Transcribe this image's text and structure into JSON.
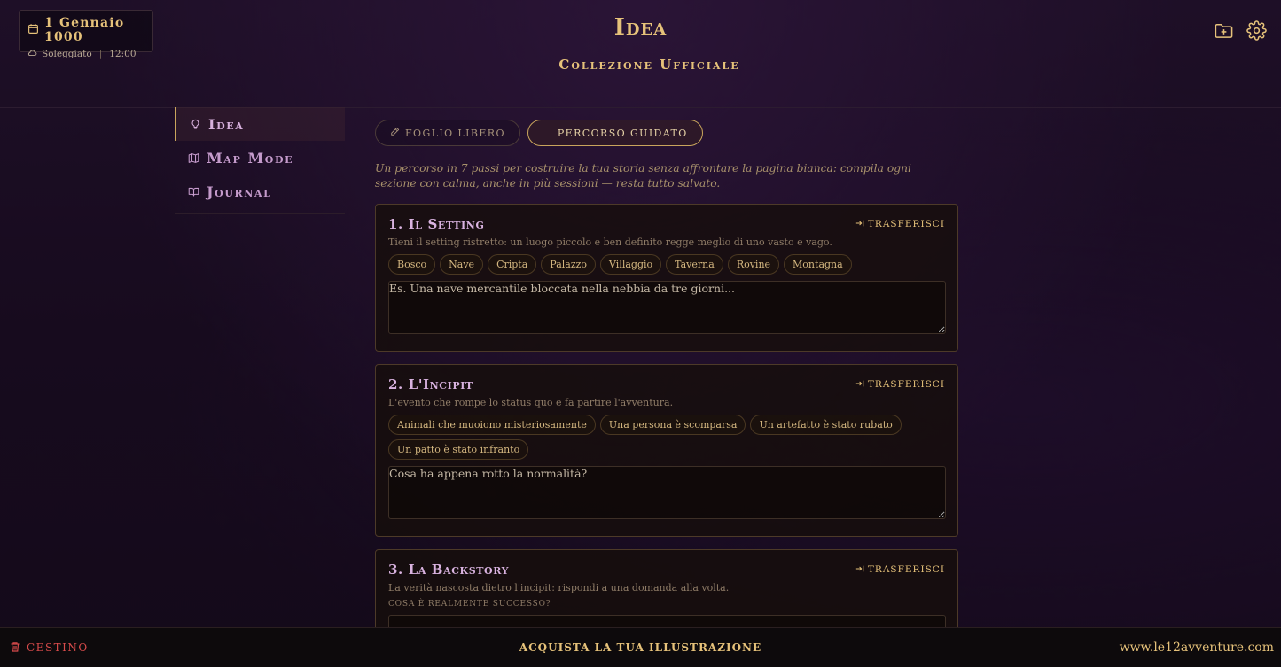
{
  "header": {
    "date": "1 Gennaio 1000",
    "weather": "Soleggiato",
    "time": "12:00",
    "title": "Idea",
    "subtitle": "Collezione Ufficiale"
  },
  "sidebar": {
    "items": [
      {
        "label": "Idea",
        "icon": "lightbulb-icon",
        "active": true
      },
      {
        "label": "Map Mode",
        "icon": "map-icon",
        "active": false
      },
      {
        "label": "Journal",
        "icon": "book-icon",
        "active": false
      }
    ]
  },
  "main": {
    "tabs": [
      {
        "label": "FOGLIO LIBERO",
        "icon": "pencil-icon",
        "active": false
      },
      {
        "label": "PERCORSO GUIDATO",
        "active": true
      }
    ],
    "intro": "Un percorso in 7 passi per costruire la tua storia senza affrontare la pagina bianca: compila ogni sezione con calma, anche in più sessioni — resta tutto salvato.",
    "transfer_label": "TRASFERISCI",
    "steps": [
      {
        "title": "1. Il Setting",
        "description": "Tieni il setting ristretto: un luogo piccolo e ben definito regge meglio di uno vasto e vago.",
        "chips": [
          "Bosco",
          "Nave",
          "Cripta",
          "Palazzo",
          "Villaggio",
          "Taverna",
          "Rovine",
          "Montagna"
        ],
        "placeholder": "Es. Una nave mercantile bloccata nella nebbia da tre giorni..."
      },
      {
        "title": "2. L'Incipit",
        "description": "L'evento che rompe lo status quo e fa partire l'avventura.",
        "chips": [
          "Animali che muoiono misteriosamente",
          "Una persona è scomparsa",
          "Un artefatto è stato rubato",
          "Un patto è stato infranto"
        ],
        "placeholder": "Cosa ha appena rotto la normalità?"
      },
      {
        "title": "3. La Backstory",
        "description": "La verità nascosta dietro l'incipit: rispondi a una domanda alla volta.",
        "field_label": "COSA È REALMENTE SUCCESSO?",
        "placeholder": ""
      }
    ]
  },
  "footer": {
    "trash": "CESTINO",
    "buy": "ACQUISTA LA TUA ILLUSTRAZIONE",
    "site": "www.le12avventure.com"
  },
  "colors": {
    "gold": "#e6c27a",
    "lilac": "#d9b3e0",
    "trash_red": "#d94b4b"
  }
}
